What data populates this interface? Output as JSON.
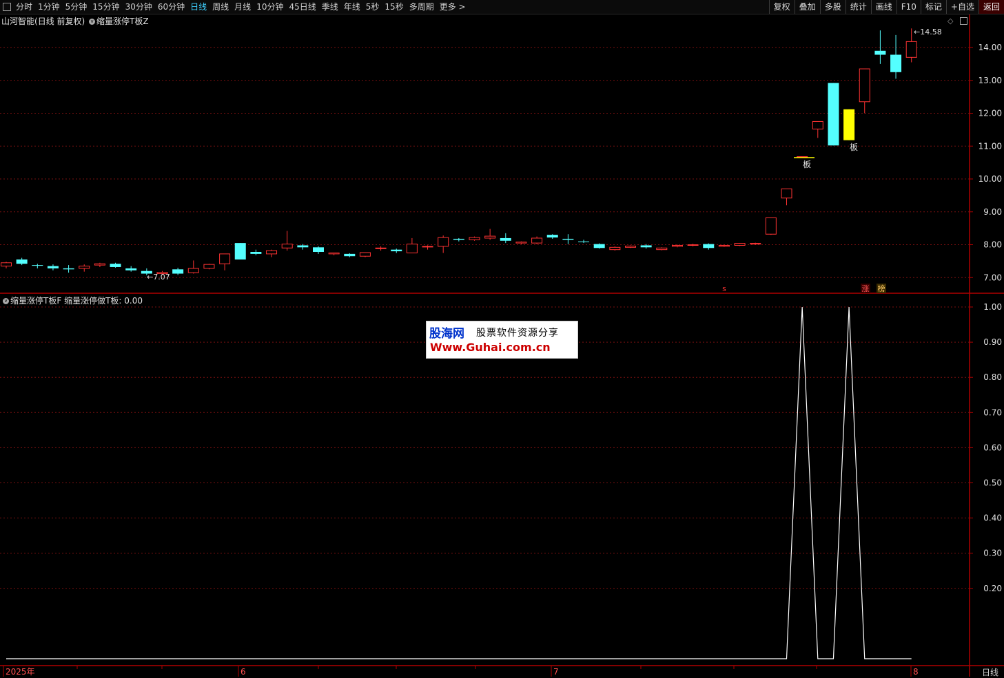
{
  "toolbar": {
    "tabs": [
      "分时",
      "1分钟",
      "5分钟",
      "15分钟",
      "30分钟",
      "60分钟",
      "日线",
      "周线",
      "月线",
      "10分钟",
      "45日线",
      "季线",
      "年线",
      "5秒",
      "15秒",
      "多周期",
      "更多 >"
    ],
    "active_tab": "日线",
    "right_buttons": [
      "复权",
      "叠加",
      "多股",
      "统计",
      "画线",
      "F10",
      "标记",
      "+自选",
      "返回"
    ]
  },
  "main_panel": {
    "stock_name": "山河智能",
    "mode": "(日线 前复权)",
    "indicator_name": "缩量涨停T板Z"
  },
  "indicator_panel": {
    "formula_name": "缩量涨停T板F",
    "line_label": "缩量涨停做T板:",
    "line_value": "0.00"
  },
  "annotations": {
    "low_price_label": "7.07",
    "high_price_label": "14.58",
    "ban_label_1": "板",
    "ban_label_2": "板",
    "marker_s": "s",
    "marker_zhang": "涨",
    "marker_bang": "榜"
  },
  "colors": {
    "up": "#ff3333",
    "down": "#54ffff",
    "highlight": "#ffff00",
    "grid": "#7a1010",
    "axis_text": "#e0e0e0",
    "line": "#ffffff"
  },
  "watermark": {
    "brand": "股海网",
    "slogan": "股票软件资源分享",
    "url": "Www.Guhai.com.cn"
  },
  "period_label": "日线",
  "chart_data": [
    {
      "type": "candlestick",
      "yticks": [
        7.0,
        8.0,
        9.0,
        10.0,
        11.0,
        12.0,
        13.0,
        14.0
      ],
      "ylim": [
        6.5,
        14.9
      ],
      "x_labels": [
        "2025年",
        "6",
        "7",
        "8"
      ],
      "candles": [
        {
          "o": 7.35,
          "h": 7.48,
          "l": 7.28,
          "c": 7.45
        },
        {
          "o": 7.55,
          "h": 7.6,
          "l": 7.38,
          "c": 7.42
        },
        {
          "o": 7.38,
          "h": 7.42,
          "l": 7.28,
          "c": 7.36
        },
        {
          "o": 7.35,
          "h": 7.4,
          "l": 7.22,
          "c": 7.28
        },
        {
          "o": 7.28,
          "h": 7.38,
          "l": 7.15,
          "c": 7.25
        },
        {
          "o": 7.28,
          "h": 7.4,
          "l": 7.18,
          "c": 7.35
        },
        {
          "o": 7.38,
          "h": 7.45,
          "l": 7.32,
          "c": 7.42
        },
        {
          "o": 7.42,
          "h": 7.45,
          "l": 7.3,
          "c": 7.32
        },
        {
          "o": 7.28,
          "h": 7.35,
          "l": 7.18,
          "c": 7.22
        },
        {
          "o": 7.2,
          "h": 7.28,
          "l": 7.07,
          "c": 7.12
        },
        {
          "o": 7.12,
          "h": 7.2,
          "l": 7.07,
          "c": 7.16
        },
        {
          "o": 7.25,
          "h": 7.3,
          "l": 7.08,
          "c": 7.12
        },
        {
          "o": 7.15,
          "h": 7.52,
          "l": 7.12,
          "c": 7.28
        },
        {
          "o": 7.28,
          "h": 7.42,
          "l": 7.25,
          "c": 7.4
        },
        {
          "o": 7.42,
          "h": 7.72,
          "l": 7.22,
          "c": 7.72
        },
        {
          "o": 8.05,
          "h": 8.05,
          "l": 7.55,
          "c": 7.55
        },
        {
          "o": 7.78,
          "h": 7.85,
          "l": 7.68,
          "c": 7.72
        },
        {
          "o": 7.72,
          "h": 7.85,
          "l": 7.62,
          "c": 7.82
        },
        {
          "o": 7.9,
          "h": 8.42,
          "l": 7.82,
          "c": 8.02
        },
        {
          "o": 7.98,
          "h": 8.02,
          "l": 7.85,
          "c": 7.92
        },
        {
          "o": 7.92,
          "h": 7.95,
          "l": 7.72,
          "c": 7.78
        },
        {
          "o": 7.72,
          "h": 7.76,
          "l": 7.68,
          "c": 7.75
        },
        {
          "o": 7.72,
          "h": 7.74,
          "l": 7.62,
          "c": 7.65
        },
        {
          "o": 7.65,
          "h": 7.76,
          "l": 7.62,
          "c": 7.76
        },
        {
          "o": 7.88,
          "h": 7.95,
          "l": 7.82,
          "c": 7.9
        },
        {
          "o": 7.85,
          "h": 7.88,
          "l": 7.75,
          "c": 7.8
        },
        {
          "o": 7.75,
          "h": 8.2,
          "l": 7.75,
          "c": 8.02
        },
        {
          "o": 7.95,
          "h": 7.98,
          "l": 7.85,
          "c": 7.95
        },
        {
          "o": 7.95,
          "h": 8.28,
          "l": 7.75,
          "c": 8.22
        },
        {
          "o": 8.18,
          "h": 8.2,
          "l": 8.1,
          "c": 8.15
        },
        {
          "o": 8.15,
          "h": 8.25,
          "l": 8.12,
          "c": 8.22
        },
        {
          "o": 8.2,
          "h": 8.48,
          "l": 8.15,
          "c": 8.26
        },
        {
          "o": 8.2,
          "h": 8.35,
          "l": 8.05,
          "c": 8.12
        },
        {
          "o": 8.05,
          "h": 8.1,
          "l": 8.02,
          "c": 8.08
        },
        {
          "o": 8.05,
          "h": 8.25,
          "l": 8.02,
          "c": 8.2
        },
        {
          "o": 8.3,
          "h": 8.32,
          "l": 8.18,
          "c": 8.22
        },
        {
          "o": 8.18,
          "h": 8.32,
          "l": 8.02,
          "c": 8.15
        },
        {
          "o": 8.1,
          "h": 8.15,
          "l": 8.05,
          "c": 8.08
        },
        {
          "o": 8.02,
          "h": 8.04,
          "l": 7.88,
          "c": 7.9
        },
        {
          "o": 7.85,
          "h": 7.95,
          "l": 7.82,
          "c": 7.92
        },
        {
          "o": 7.92,
          "h": 7.98,
          "l": 7.9,
          "c": 7.96
        },
        {
          "o": 7.98,
          "h": 8.02,
          "l": 7.88,
          "c": 7.92
        },
        {
          "o": 7.85,
          "h": 7.92,
          "l": 7.83,
          "c": 7.9
        },
        {
          "o": 7.95,
          "h": 8.0,
          "l": 7.92,
          "c": 7.98
        },
        {
          "o": 7.98,
          "h": 8.03,
          "l": 7.95,
          "c": 8.0
        },
        {
          "o": 8.02,
          "h": 8.04,
          "l": 7.85,
          "c": 7.9
        },
        {
          "o": 7.95,
          "h": 8.0,
          "l": 7.93,
          "c": 7.98
        },
        {
          "o": 7.98,
          "h": 8.05,
          "l": 7.96,
          "c": 8.04
        },
        {
          "o": 8.02,
          "h": 8.06,
          "l": 8.0,
          "c": 8.04
        },
        {
          "o": 8.32,
          "h": 8.82,
          "l": 8.3,
          "c": 8.82
        },
        {
          "o": 9.42,
          "h": 9.7,
          "l": 9.2,
          "c": 9.7
        },
        {
          "o": 10.68,
          "h": 10.68,
          "l": 10.68,
          "c": 10.68
        },
        {
          "o": 11.52,
          "h": 11.75,
          "l": 11.25,
          "c": 11.75
        },
        {
          "o": 12.92,
          "h": 12.92,
          "l": 11.02,
          "c": 11.02
        },
        {
          "o": 11.18,
          "h": 12.12,
          "l": 11.18,
          "c": 12.12
        },
        {
          "o": 12.35,
          "h": 13.35,
          "l": 12.0,
          "c": 13.35
        },
        {
          "o": 13.9,
          "h": 14.52,
          "l": 13.5,
          "c": 13.78
        },
        {
          "o": 13.78,
          "h": 14.38,
          "l": 13.05,
          "c": 13.25
        },
        {
          "o": 13.7,
          "h": 14.58,
          "l": 13.55,
          "c": 14.18
        }
      ]
    },
    {
      "type": "line",
      "name": "缩量涨停做T板",
      "yticks": [
        0.2,
        0.3,
        0.4,
        0.5,
        0.6,
        0.7,
        0.8,
        0.9,
        1.0
      ],
      "ylim": [
        0.0,
        1.0
      ],
      "values": [
        0,
        0,
        0,
        0,
        0,
        0,
        0,
        0,
        0,
        0,
        0,
        0,
        0,
        0,
        0,
        0,
        0,
        0,
        0,
        0,
        0,
        0,
        0,
        0,
        0,
        0,
        0,
        0,
        0,
        0,
        0,
        0,
        0,
        0,
        0,
        0,
        0,
        0,
        0,
        0,
        0,
        0,
        0,
        0,
        0,
        0,
        0,
        0,
        0,
        0,
        0,
        1,
        0,
        0,
        1,
        0,
        0,
        0,
        0
      ]
    }
  ]
}
